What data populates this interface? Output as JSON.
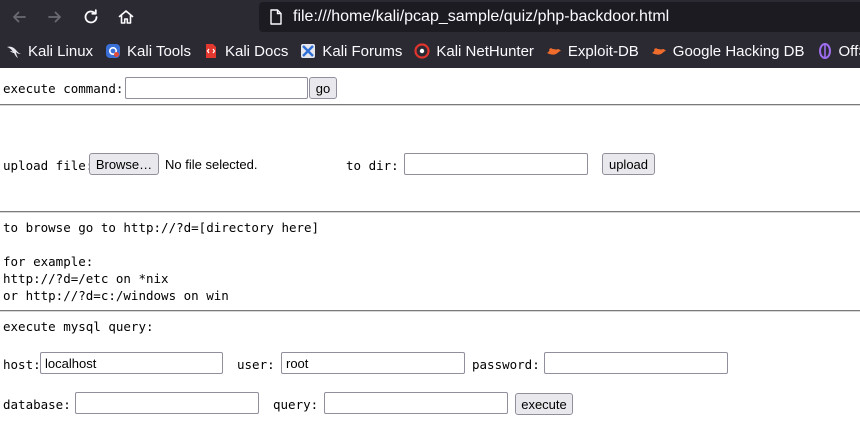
{
  "browser": {
    "url": "file:///home/kali/pcap_sample/quiz/php-backdoor.html",
    "toolbar_icons": [
      "back-arrow-icon",
      "forward-arrow-icon",
      "reload-icon",
      "home-icon",
      "page-icon"
    ],
    "bookmarks": [
      {
        "label": "Kali Linux",
        "icon": "kali-dragon-icon"
      },
      {
        "label": "Kali Tools",
        "icon": "kali-tools-icon"
      },
      {
        "label": "Kali Docs",
        "icon": "kali-docs-icon"
      },
      {
        "label": "Kali Forums",
        "icon": "kali-forums-icon"
      },
      {
        "label": "Kali NetHunter",
        "icon": "nethunter-icon"
      },
      {
        "label": "Exploit-DB",
        "icon": "exploit-db-icon"
      },
      {
        "label": "Google Hacking DB",
        "icon": "ghdb-icon"
      },
      {
        "label": "OffSec",
        "icon": "offsec-icon"
      }
    ],
    "colors": {
      "chrome_bg": "#2b2a33",
      "urlbar_bg": "#1c1b22",
      "chrome_text": "#fbfbfe"
    }
  },
  "command": {
    "label": "execute command:",
    "value": "",
    "button": "go"
  },
  "upload": {
    "label": "upload file:",
    "browse_button": "Browse…",
    "file_status": "No file selected.",
    "dir_label": "to dir:",
    "dir_value": "",
    "button": "upload"
  },
  "browse_info": {
    "line1": "to browse go to http://?d=[directory here]",
    "line2": "for example:",
    "line3": "http://?d=/etc on *nix",
    "line4": "or http://?d=c:/windows on win"
  },
  "mysql": {
    "heading": "execute mysql query:",
    "host_label": "host:",
    "host_value": "localhost",
    "user_label": "user:",
    "user_value": "root",
    "password_label": "password:",
    "password_value": "",
    "database_label": "database:",
    "database_value": "",
    "query_label": "query:",
    "query_value": "",
    "button": "execute"
  }
}
